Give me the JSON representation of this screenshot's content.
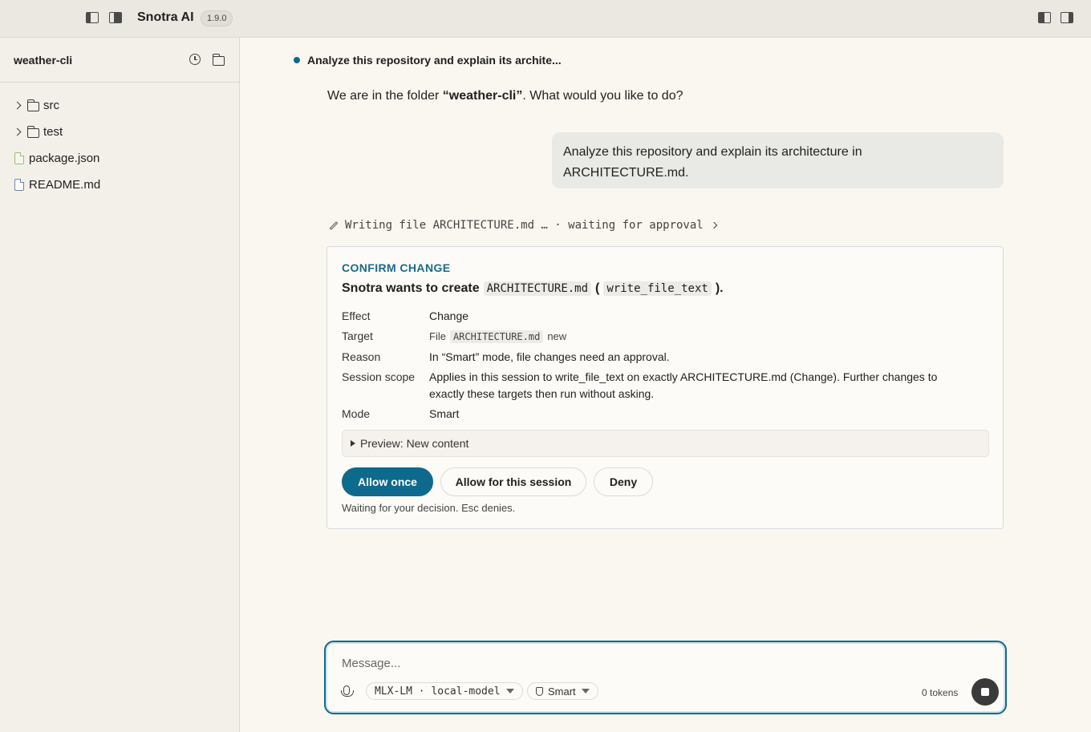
{
  "app": {
    "title": "Snotra AI",
    "version": "1.9.0"
  },
  "sidebar": {
    "project": "weather-cli",
    "items": [
      {
        "label": "src",
        "type": "folder"
      },
      {
        "label": "test",
        "type": "folder"
      },
      {
        "label": "package.json",
        "type": "file"
      },
      {
        "label": "README.md",
        "type": "file"
      }
    ]
  },
  "chat": {
    "task_title": "Analyze this repository and explain its archite...",
    "assistant_prefix": "We are in the folder ",
    "assistant_folder": "“weather-cli”",
    "assistant_suffix": ". What would you like to do?",
    "user_message_line1": "Analyze this repository and explain its architecture in",
    "user_message_line2": "ARCHITECTURE.md.",
    "status_text": "Writing file ARCHITECTURE.md … · waiting for approval"
  },
  "confirm": {
    "heading": "CONFIRM CHANGE",
    "title_prefix": "Snotra wants to create",
    "title_file": "ARCHITECTURE.md",
    "title_paren_open": "(",
    "title_tool": "write_file_text",
    "title_paren_close": ").",
    "rows": {
      "effect_label": "Effect",
      "effect_value": "Change",
      "target_label": "Target",
      "target_kind": "File",
      "target_file": "ARCHITECTURE.md",
      "target_status": "new",
      "reason_label": "Reason",
      "reason_value": "In “Smart” mode, file changes need an approval.",
      "scope_label": "Session scope",
      "scope_line1": "Applies in this session to write_file_text on exactly ARCHITECTURE.md (Change). Further changes to",
      "scope_line2": "exactly these targets then run without asking.",
      "mode_label": "Mode",
      "mode_value": "Smart"
    },
    "preview_label": "Preview: New content",
    "buttons": {
      "allow_once": "Allow once",
      "allow_session": "Allow for this session",
      "deny": "Deny"
    },
    "footer": "Waiting for your decision. Esc denies."
  },
  "composer": {
    "placeholder": "Message...",
    "model": "MLX-LM · local-model",
    "mode": "Smart",
    "tokens": "0 tokens"
  },
  "colors": {
    "accent": "#0e6a8c",
    "background": "#faf7f0",
    "sidebar": "#f3f0ea"
  }
}
